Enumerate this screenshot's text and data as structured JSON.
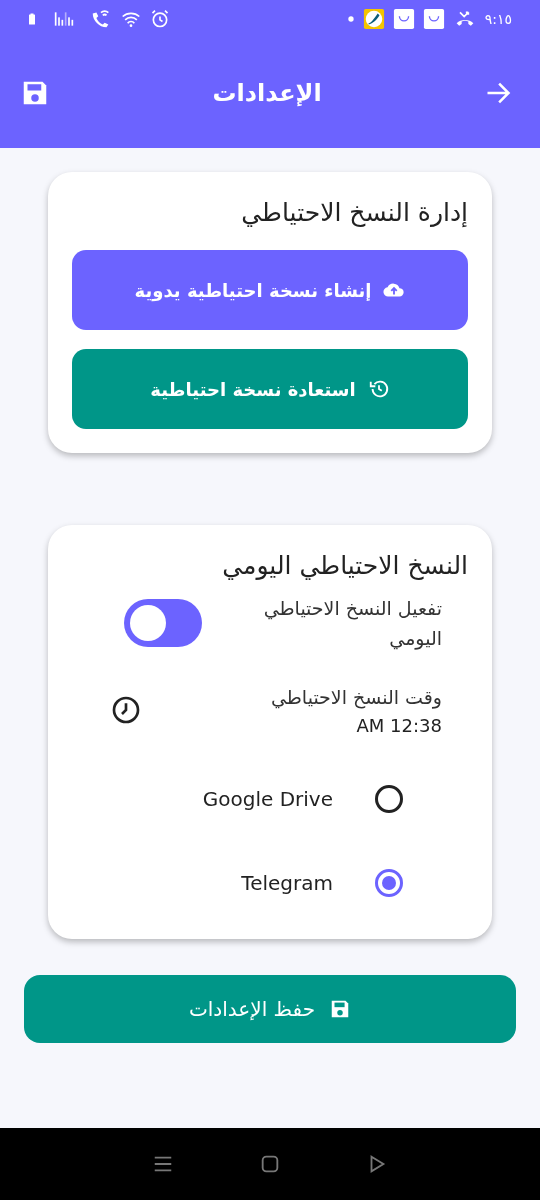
{
  "status_bar": {
    "time": "٩:١٥"
  },
  "header": {
    "title": "الإعدادات"
  },
  "backup_card": {
    "title": "إدارة النسخ الاحتياطي",
    "buttons": [
      {
        "label": "إنشاء نسخة احتياطية يدوية",
        "kind": "upload"
      },
      {
        "label": "استعادة نسخة احتياطية",
        "kind": "restore"
      }
    ]
  },
  "daily_card": {
    "title": "النسخ الاحتياطي اليومي",
    "toggle": {
      "label": "تفعيل النسخ الاحتياطي اليومي",
      "on": true
    },
    "time_setting": {
      "label": "وقت النسخ الاحتياطي",
      "value": "AM 12:38"
    },
    "destinations": [
      {
        "label": "Google Drive",
        "selected": false
      },
      {
        "label": "Telegram",
        "selected": true
      }
    ]
  },
  "save_button": {
    "label": "حفظ الإعدادات"
  }
}
